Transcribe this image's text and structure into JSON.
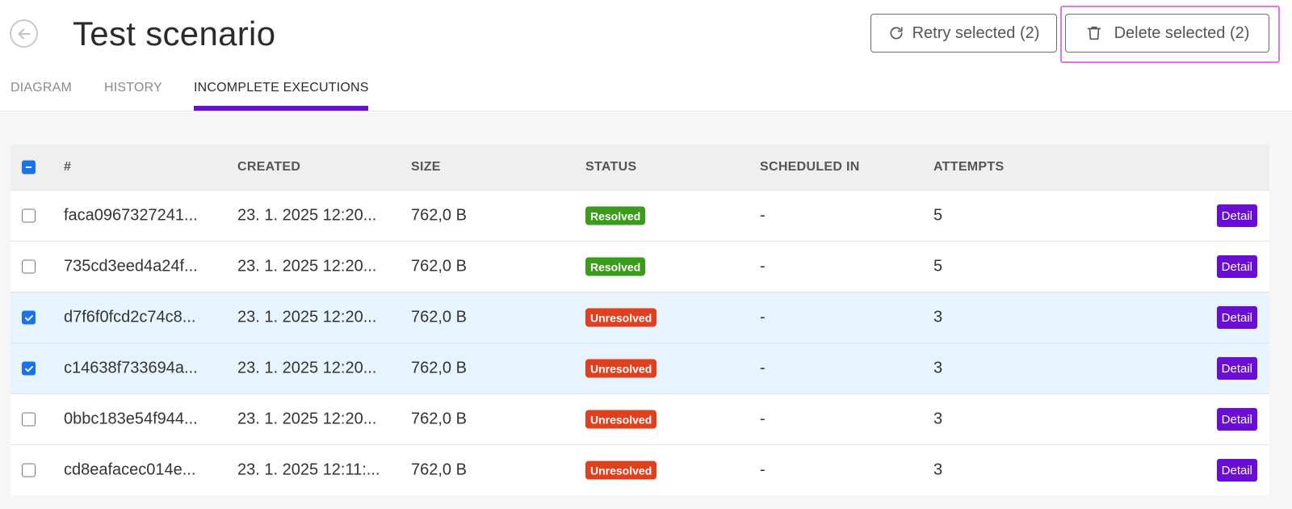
{
  "header": {
    "title": "Test scenario",
    "retry_label": "Retry selected (2)",
    "delete_label": "Delete selected (2)"
  },
  "tabs": [
    {
      "label": "DIAGRAM",
      "active": false
    },
    {
      "label": "HISTORY",
      "active": false
    },
    {
      "label": "INCOMPLETE EXECUTIONS",
      "active": true
    }
  ],
  "table": {
    "columns": [
      "#",
      "CREATED",
      "SIZE",
      "STATUS",
      "SCHEDULED IN",
      "ATTEMPTS"
    ],
    "detail_label": "Detail",
    "rows": [
      {
        "id": "faca0967327241...",
        "created": "23. 1. 2025 12:20...",
        "size": "762,0 B",
        "status": "Resolved",
        "scheduled": "-",
        "attempts": "5",
        "selected": false
      },
      {
        "id": "735cd3eed4a24f...",
        "created": "23. 1. 2025 12:20...",
        "size": "762,0 B",
        "status": "Resolved",
        "scheduled": "-",
        "attempts": "5",
        "selected": false
      },
      {
        "id": "d7f6f0fcd2c74c8...",
        "created": "23. 1. 2025 12:20...",
        "size": "762,0 B",
        "status": "Unresolved",
        "scheduled": "-",
        "attempts": "3",
        "selected": true
      },
      {
        "id": "c14638f733694a...",
        "created": "23. 1. 2025 12:20...",
        "size": "762,0 B",
        "status": "Unresolved",
        "scheduled": "-",
        "attempts": "3",
        "selected": true
      },
      {
        "id": "0bbc183e54f944...",
        "created": "23. 1. 2025 12:20...",
        "size": "762,0 B",
        "status": "Unresolved",
        "scheduled": "-",
        "attempts": "3",
        "selected": false
      },
      {
        "id": "cd8eafacec014e...",
        "created": "23. 1. 2025 12:11:...",
        "size": "762,0 B",
        "status": "Unresolved",
        "scheduled": "-",
        "attempts": "3",
        "selected": false
      }
    ]
  },
  "colors": {
    "accent": "#6a0dd6",
    "resolved": "#3a9c1a",
    "unresolved": "#e0401e",
    "selected_row": "#e8f4fd",
    "checkbox": "#1a73e8",
    "highlight": "#e075e8"
  }
}
